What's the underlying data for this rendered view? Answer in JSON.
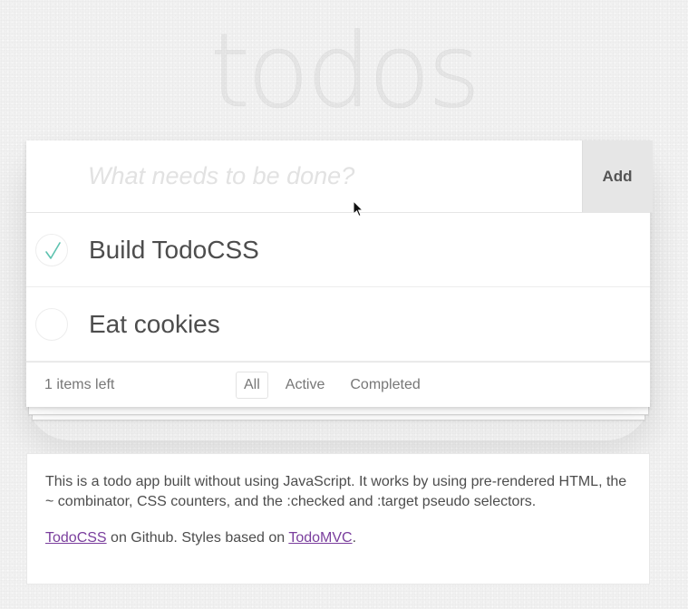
{
  "app": {
    "title": "todos",
    "input_placeholder": "What needs to be done?",
    "add_label": "Add"
  },
  "todos": [
    {
      "label": "Build TodoCSS",
      "completed": true
    },
    {
      "label": "Eat cookies",
      "completed": false
    }
  ],
  "footer": {
    "count_text": "1 items left",
    "filters": [
      {
        "label": "All",
        "selected": true
      },
      {
        "label": "Active",
        "selected": false
      },
      {
        "label": "Completed",
        "selected": false
      }
    ]
  },
  "info": {
    "paragraph1": "This is a todo app built without using JavaScript. It works by using pre-rendered HTML, the ~ combinator, CSS counters, and the :checked and :target pseudo selectors.",
    "link_todocss": "TodoCSS",
    "text_on_github": " on Github. Styles based on ",
    "link_todomvc": "TodoMVC",
    "text_period": "."
  },
  "colors": {
    "checkmark": "#5dc2af",
    "link": "#7a3e9d",
    "add_button_bg": "#e6e6e6"
  },
  "icons": {
    "checkmark": "check-icon",
    "cursor": "mouse-pointer-icon"
  }
}
